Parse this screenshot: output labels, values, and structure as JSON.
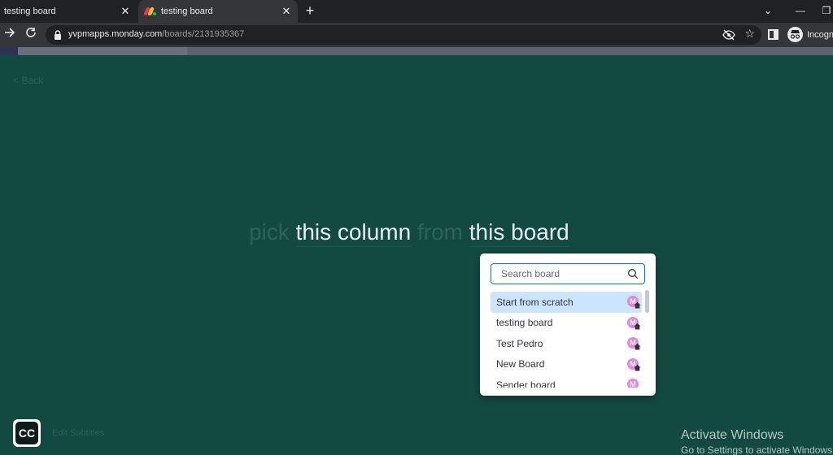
{
  "browser": {
    "tabs": [
      {
        "label": "testing board",
        "active": false
      },
      {
        "label": "testing board",
        "active": true
      }
    ],
    "tab_close_glyph": "✕",
    "new_tab_glyph": "+",
    "window_controls": [
      "⌄",
      "—",
      "❐"
    ],
    "url_host": "yvpmapps.monday.com",
    "url_path": "/boards/2131935367",
    "incognito_label": "Incognito"
  },
  "app": {
    "back_link": "< Back",
    "sentence": {
      "word1": "pick",
      "word2": "this column",
      "word3": "from",
      "word4": "this board"
    },
    "board_picker": {
      "search_placeholder": "Search board",
      "items": [
        {
          "label": "Start from scratch",
          "avatar": "M",
          "selected": true
        },
        {
          "label": "testing board",
          "avatar": "M",
          "selected": false
        },
        {
          "label": "Test Pedro",
          "avatar": "M",
          "selected": false
        },
        {
          "label": "New Board",
          "avatar": "M",
          "selected": false
        },
        {
          "label": "Sender board",
          "avatar": "M",
          "selected": false
        }
      ]
    },
    "cc_button": "CC",
    "cc_label": "Edit Subtitles"
  },
  "os_watermark": {
    "title": "Activate Windows",
    "subtitle": "Go to Settings to activate Windows."
  },
  "colors": {
    "app_background": "#124a42",
    "accent_blue": "#0073ea",
    "selected_row": "#cce5ff",
    "avatar_pink": "#e484e3"
  }
}
